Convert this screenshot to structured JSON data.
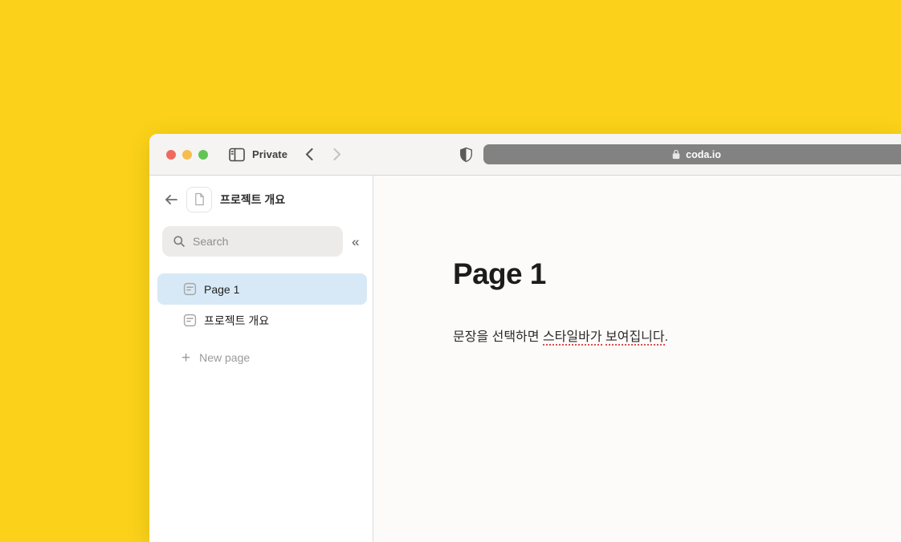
{
  "colors": {
    "desktop_background": "#FBD219",
    "toolbar_bg": "#F5F4F2",
    "url_bar_bg": "#828282",
    "selected_page_bg": "#D7E9F6",
    "spellcheck_underline": "#DD4E4E",
    "traffic_red": "#EE6A5F",
    "traffic_yellow": "#F5BD4F",
    "traffic_green": "#61C554"
  },
  "browser": {
    "private_label": "Private",
    "url_bar": {
      "domain": "coda.io"
    }
  },
  "icons": {
    "collapse_sidebar": "«",
    "add": "+"
  },
  "sidebar": {
    "header": {
      "title": "프로젝트 개요"
    },
    "search": {
      "placeholder": "Search"
    },
    "pages": [
      {
        "label": "Page 1",
        "selected": true
      },
      {
        "label": "프로젝트 개요",
        "selected": false
      }
    ],
    "new_page_label": "New page"
  },
  "main": {
    "title": "Page 1",
    "paragraph": {
      "part1": "문장을 선택하면 ",
      "underlined1": "스타일바가",
      "part2": " ",
      "underlined2": "보여집니다",
      "part3": "."
    }
  }
}
